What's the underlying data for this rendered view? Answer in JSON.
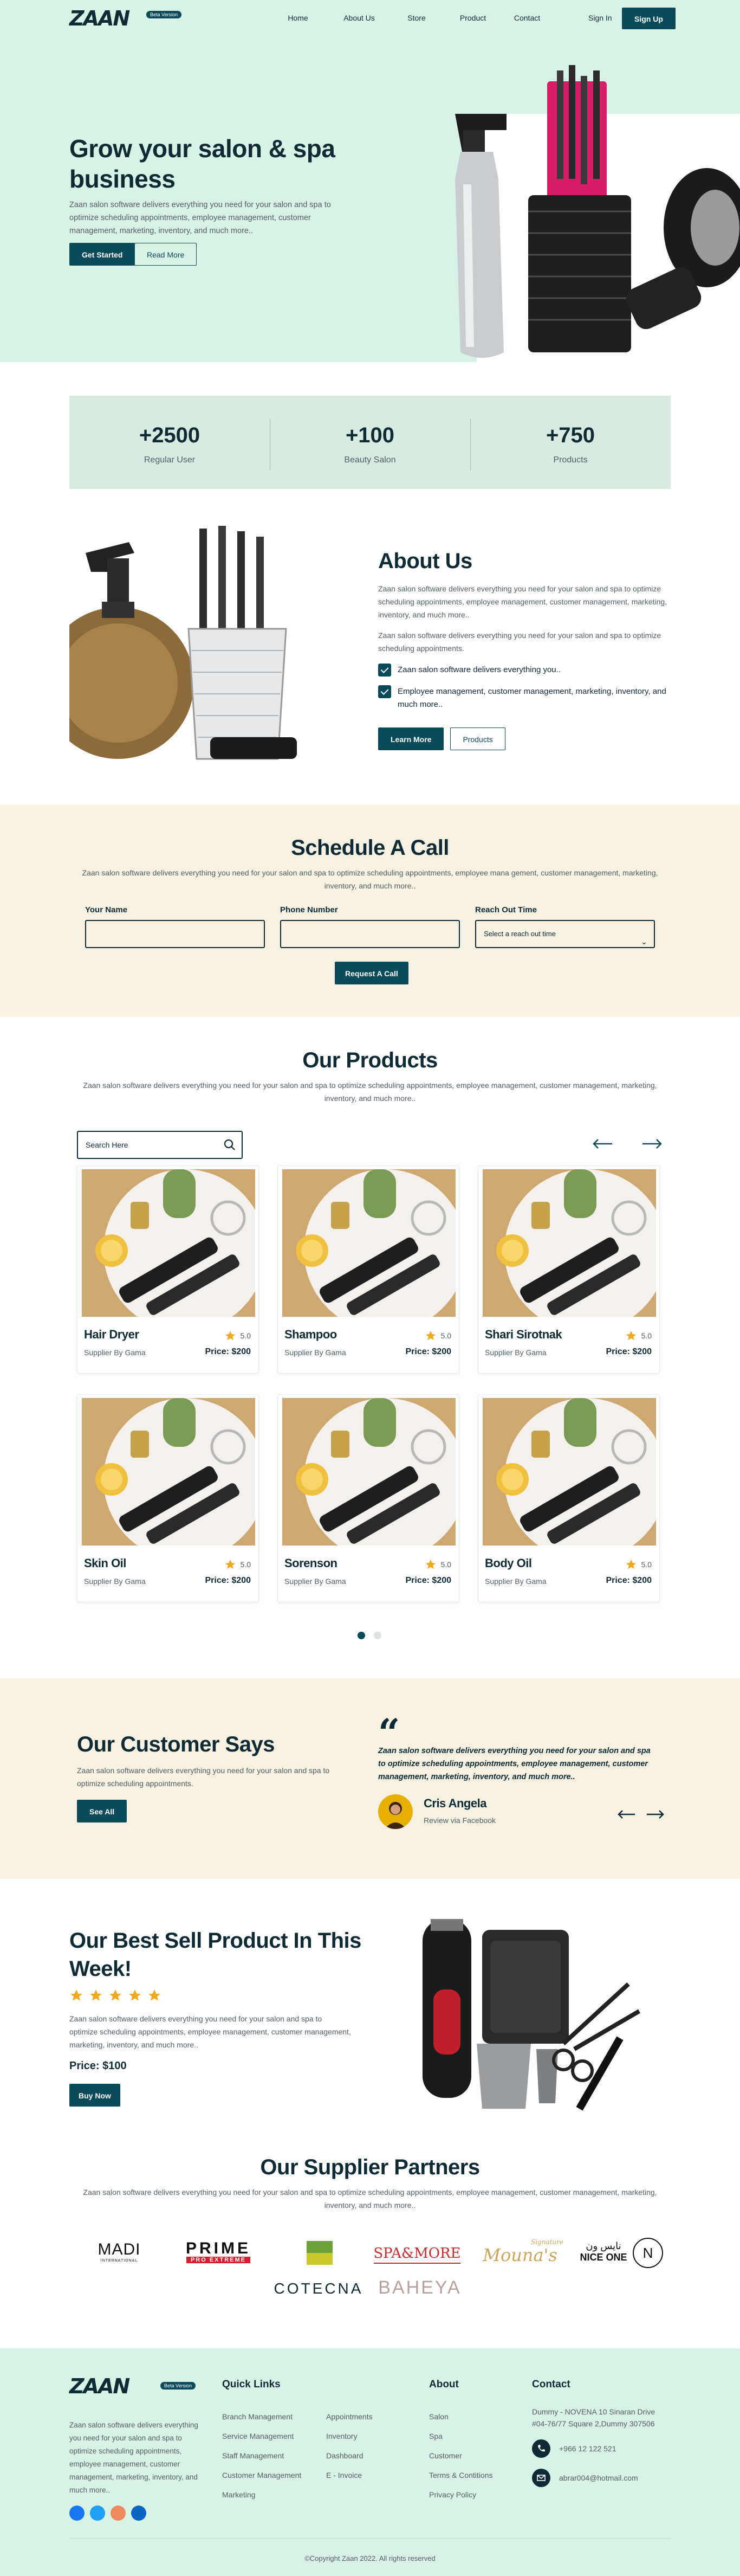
{
  "header": {
    "logo_text": "ZAAN",
    "badge": "Beta Version",
    "nav": [
      "Home",
      "About Us",
      "Store",
      "Product",
      "Contact"
    ],
    "signin": "Sign In",
    "signup": "Sign Up"
  },
  "hero": {
    "title": "Grow your salon & spa business",
    "text": "Zaan salon software delivers everything you need for your salon and spa to optimize scheduling appointments, employee management, customer management, marketing, inventory, and much more..",
    "primary": "Get Started",
    "secondary": "Read More"
  },
  "stats": [
    {
      "number": "+2500",
      "label": "Regular User"
    },
    {
      "number": "+100",
      "label": "Beauty Salon"
    },
    {
      "number": "+750",
      "label": "Products"
    }
  ],
  "about": {
    "title": "About Us",
    "p1": "Zaan salon software delivers everything you need for your salon and spa to optimize scheduling appointments, employee management, customer management, marketing, inventory, and much more..",
    "p2": "Zaan salon software delivers everything you need for your salon and spa to optimize scheduling appointments.",
    "check1": "Zaan salon software delivers everything you..",
    "check2": "Employee management, customer management, marketing, inventory, and much more..",
    "learn": "Learn More",
    "products": "Products"
  },
  "schedule": {
    "title": "Schedule A Call",
    "text": "Zaan salon software delivers everything you need for your salon and spa to optimize scheduling appointments, employee mana gement, customer management, marketing, inventory, and much more..",
    "name_label": "Your Name",
    "phone_label": "Phone Number",
    "time_label": "Reach Out Time",
    "time_placeholder": "Select a reach out time",
    "submit": "Request A Call"
  },
  "products": {
    "title": "Our Products",
    "text": "Zaan salon software delivers everything you need for your salon and spa to optimize scheduling appointments, employee management, customer management, marketing, inventory, and much more..",
    "search_placeholder": "Search Here",
    "items": [
      {
        "name": "Hair Dryer",
        "rating": "5.0",
        "supplier": "Supplier By Gama",
        "price": "Price: $200"
      },
      {
        "name": "Shampoo",
        "rating": "5.0",
        "supplier": "Supplier By Gama",
        "price": "Price: $200"
      },
      {
        "name": "Shari Sirotnak",
        "rating": "5.0",
        "supplier": "Supplier By Gama",
        "price": "Price: $200"
      },
      {
        "name": "Skin Oil",
        "rating": "5.0",
        "supplier": "Supplier By Gama",
        "price": "Price: $200"
      },
      {
        "name": "Sorenson",
        "rating": "5.0",
        "supplier": "Supplier By Gama",
        "price": "Price: $200"
      },
      {
        "name": "Body Oil",
        "rating": "5.0",
        "supplier": "Supplier By Gama",
        "price": "Price: $200"
      }
    ]
  },
  "testimonial": {
    "title": "Our Customer Says",
    "text": "Zaan salon software delivers everything you need for your salon and spa to optimize scheduling appointments.",
    "see_all": "See All",
    "quote": "Zaan salon software delivers everything you need for your salon and spa to optimize scheduling appointments, employee management, customer management, marketing, inventory, and much more..",
    "author": "Cris Angela",
    "via": "Review via Facebook"
  },
  "best": {
    "title": "Our Best Sell Product In This Week!",
    "rating": 5,
    "text": "Zaan salon software delivers everything you need for your salon and spa to optimize scheduling appointments, employee management, customer management, marketing, inventory, and much more..",
    "price": "Price: $100",
    "buy": "Buy Now"
  },
  "partners": {
    "title": "Our Supplier Partners",
    "text": "Zaan salon software delivers everything you need for your salon and spa to optimize scheduling appointments, employee management, customer management, marketing, inventory, and much more..",
    "logos": [
      "MADI",
      "PRIME",
      "PRO EXTREME",
      "SPA&MORE",
      "Mouna's",
      "Signature",
      "نايس ون",
      "NICE ONE",
      "N",
      "COTECNA",
      "BAHEYA",
      "INTERNATIONAL"
    ]
  },
  "footer": {
    "badge": "Beta Version",
    "desc": "Zaan salon software delivers everything you need for your salon and spa to optimize scheduling appointments, employee management, customer management, marketing, inventory, and much more..",
    "quick_title": "Quick Links",
    "quick_col1": [
      "Branch Management",
      "Service Management",
      "Staff Management",
      "Customer Management",
      "Marketing"
    ],
    "quick_col2": [
      "Appointments",
      "Inventory",
      "Dashboard",
      "E - Invoice"
    ],
    "about_title": "About",
    "about_links": [
      "Salon",
      "Spa",
      "Customer",
      "Terms & Contitions",
      "Privacy Policy"
    ],
    "contact_title": "Contact",
    "address": "Dummy - NOVENA 10 Sinaran Drive #04-76/77 Square 2,Dummy 307506",
    "phone": "+966 12 122 521",
    "email": "abrar004@hotmail.com",
    "copyright": "©Copyright Zaan 2022. All rights reserved"
  }
}
